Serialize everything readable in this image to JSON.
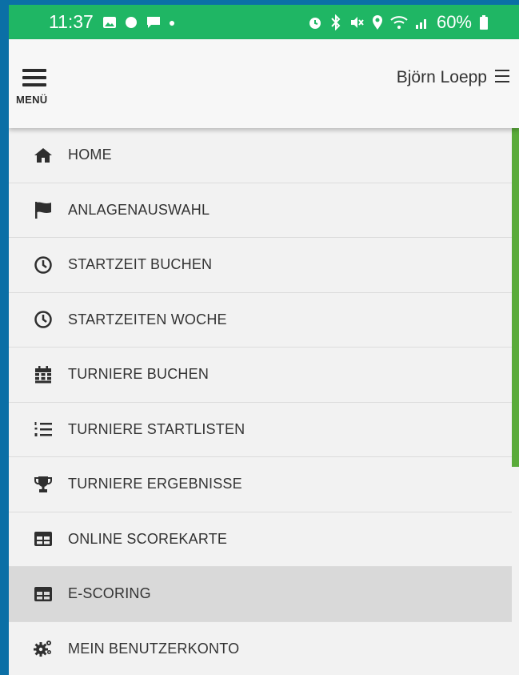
{
  "status_bar": {
    "time": "11:37",
    "battery": "60%",
    "background_color": "#1fb664"
  },
  "header": {
    "menu_label": "MENÜ",
    "user_name": "Björn Loepp"
  },
  "nav": {
    "items": [
      {
        "label": "HOME",
        "icon": "home-icon"
      },
      {
        "label": "ANLAGENAUSWAHL",
        "icon": "flag-icon"
      },
      {
        "label": "STARTZEIT BUCHEN",
        "icon": "clock-icon"
      },
      {
        "label": "STARTZEITEN WOCHE",
        "icon": "clock-icon"
      },
      {
        "label": "TURNIERE BUCHEN",
        "icon": "calendar-icon"
      },
      {
        "label": "TURNIERE STARTLISTEN",
        "icon": "numbered-list-icon"
      },
      {
        "label": "TURNIERE ERGEBNISSE",
        "icon": "trophy-icon"
      },
      {
        "label": "ONLINE SCOREKARTE",
        "icon": "table-icon"
      },
      {
        "label": "E-SCORING",
        "icon": "table-icon",
        "active": true
      },
      {
        "label": "MEIN BENUTZERKONTO",
        "icon": "gears-icon"
      }
    ]
  },
  "scrollbar": {
    "position_fraction": 0,
    "visible_fraction": 0.62,
    "color": "#5aab3a"
  }
}
